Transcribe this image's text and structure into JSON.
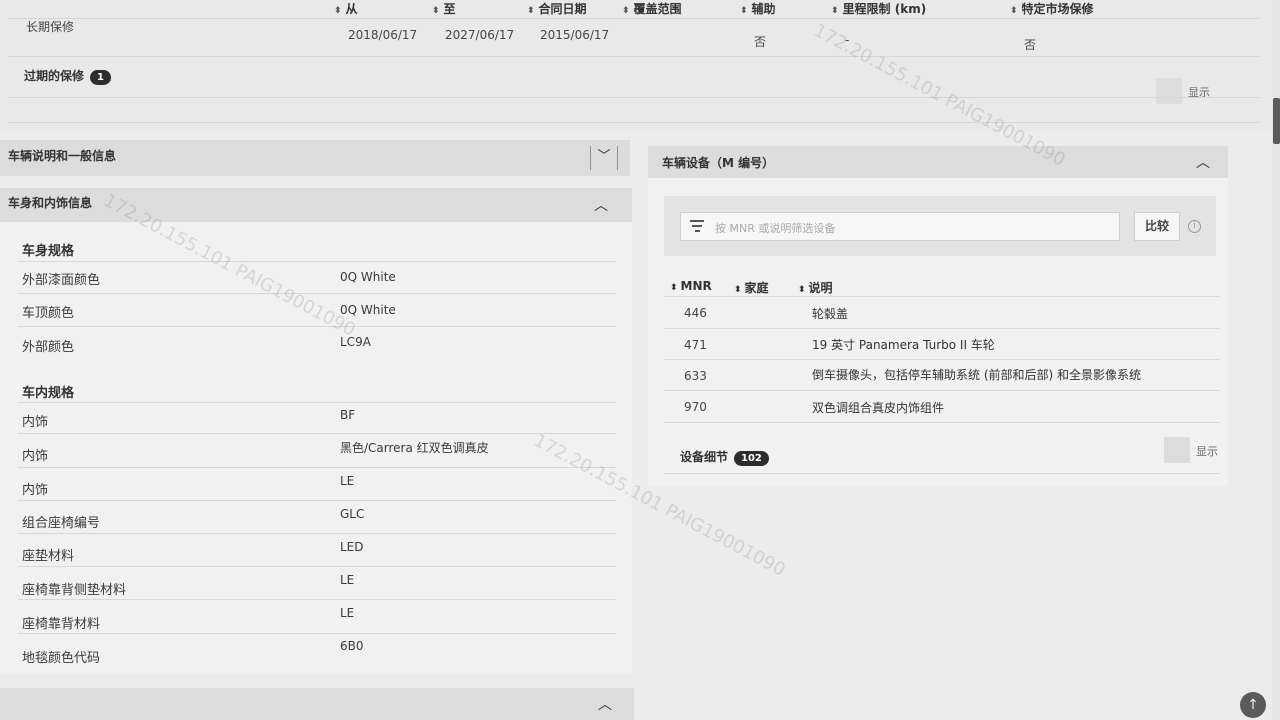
{
  "warranty_table": {
    "columns": {
      "from": "从",
      "to": "至",
      "contract_date": "合同日期",
      "coverage": "覆盖范围",
      "auxiliary": "辅助",
      "mileage_limit": "里程限制 (km)",
      "specific_market": "特定市场保修"
    },
    "row": {
      "name": "长期保修",
      "from": "2018/06/17",
      "to": "2027/06/17",
      "contract_date": "2015/06/17",
      "auxiliary": "否",
      "mileage_limit": "-",
      "specific_market": "否"
    },
    "expired_label": "过期的保修",
    "expired_count": "1",
    "show_label": "显示"
  },
  "panels": {
    "vehicle_description": {
      "title": "车辆说明和一般信息"
    },
    "body_interior": {
      "title": "车身和内饰信息",
      "body_spec_title": "车身规格",
      "body_rows": [
        {
          "label": "外部漆面颜色",
          "value": "0Q White"
        },
        {
          "label": "车顶颜色",
          "value": "0Q White"
        },
        {
          "label": "外部颜色",
          "value": "LC9A"
        }
      ],
      "interior_spec_title": "车内规格",
      "interior_rows": [
        {
          "label": "内饰",
          "value": "BF"
        },
        {
          "label": "内饰",
          "value": "黑色/Carrera 红双色调真皮"
        },
        {
          "label": "内饰",
          "value": "LE"
        },
        {
          "label": "组合座椅编号",
          "value": "GLC"
        },
        {
          "label": "座垫材料",
          "value": "LED"
        },
        {
          "label": "座椅靠背侧垫材料",
          "value": "LE"
        },
        {
          "label": "座椅靠背材料",
          "value": "LE"
        },
        {
          "label": "地毯颜色代码",
          "value": "6B0"
        }
      ]
    },
    "equipment": {
      "title": "车辆设备（M 编号）",
      "search_placeholder": "按 MNR 或说明筛选设备",
      "compare_label": "比较",
      "columns": {
        "mnr": "MNR",
        "family": "家庭",
        "description": "说明"
      },
      "rows": [
        {
          "mnr": "446",
          "description": "轮毂盖"
        },
        {
          "mnr": "471",
          "description": "19 英寸 Panamera Turbo II 车轮"
        },
        {
          "mnr": "633",
          "description": "倒车摄像头，包括停车辅助系统 (前部和后部) 和全景影像系统"
        },
        {
          "mnr": "970",
          "description": "双色调组合真皮内饰组件"
        }
      ],
      "details_label": "设备细节",
      "details_count": "102",
      "show_label": "显示"
    }
  },
  "watermark_text": "172.20.155.101  PAIG19001090"
}
